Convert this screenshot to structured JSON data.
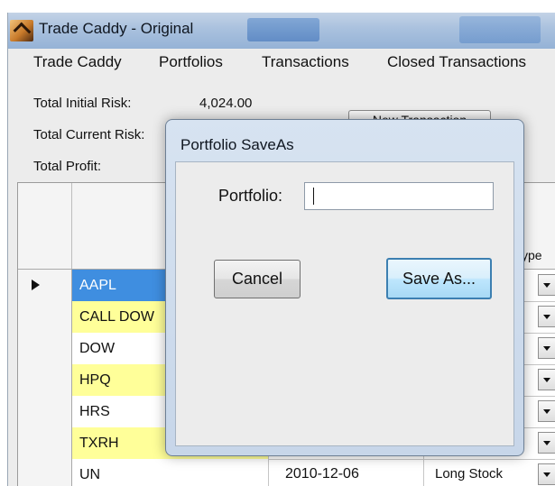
{
  "window": {
    "title": "Trade Caddy - Original"
  },
  "menu": [
    "Trade Caddy",
    "Portfolios",
    "Transactions",
    "Closed Transactions"
  ],
  "summary": {
    "initial_risk_label": "Total Initial Risk:",
    "initial_risk_value": "4,024.00",
    "current_risk_label": "Total Current Risk:",
    "profit_label": "Total Profit:",
    "new_transaction_label": "New Transaction"
  },
  "grid": {
    "type_header_partial": "ype",
    "rows": [
      {
        "symbol": "AAPL",
        "bg": "#3f8ee0",
        "selected": true,
        "date": "",
        "type": ""
      },
      {
        "symbol": "CALL DOW",
        "bg": "#ffff99",
        "selected": false,
        "date": "",
        "type": ""
      },
      {
        "symbol": "DOW",
        "bg": "#ffffff",
        "selected": false,
        "date": "",
        "type": ""
      },
      {
        "symbol": "HPQ",
        "bg": "#ffff99",
        "selected": false,
        "date": "",
        "type": ""
      },
      {
        "symbol": "HRS",
        "bg": "#ffffff",
        "selected": false,
        "date": "",
        "type": ""
      },
      {
        "symbol": "TXRH",
        "bg": "#ffff99",
        "selected": false,
        "date": "",
        "type": ""
      },
      {
        "symbol": "UN",
        "bg": "#ffffff",
        "selected": false,
        "date": "2010-12-06",
        "type": "Long Stock"
      }
    ]
  },
  "dialog": {
    "title": "Portfolio SaveAs",
    "portfolio_label": "Portfolio:",
    "portfolio_value": "",
    "cancel_label": "Cancel",
    "save_as_label": "Save As..."
  },
  "colors": {
    "titlebar": "#a9c1de",
    "dialog_frame": "#c7d6e9",
    "selected_row": "#3f8ee0",
    "highlight_row": "#ffff99",
    "default_button_border": "#3c7fb1"
  },
  "icons": [
    "app-icon",
    "row-pointer-icon",
    "dropdown-arrow-icon"
  ]
}
